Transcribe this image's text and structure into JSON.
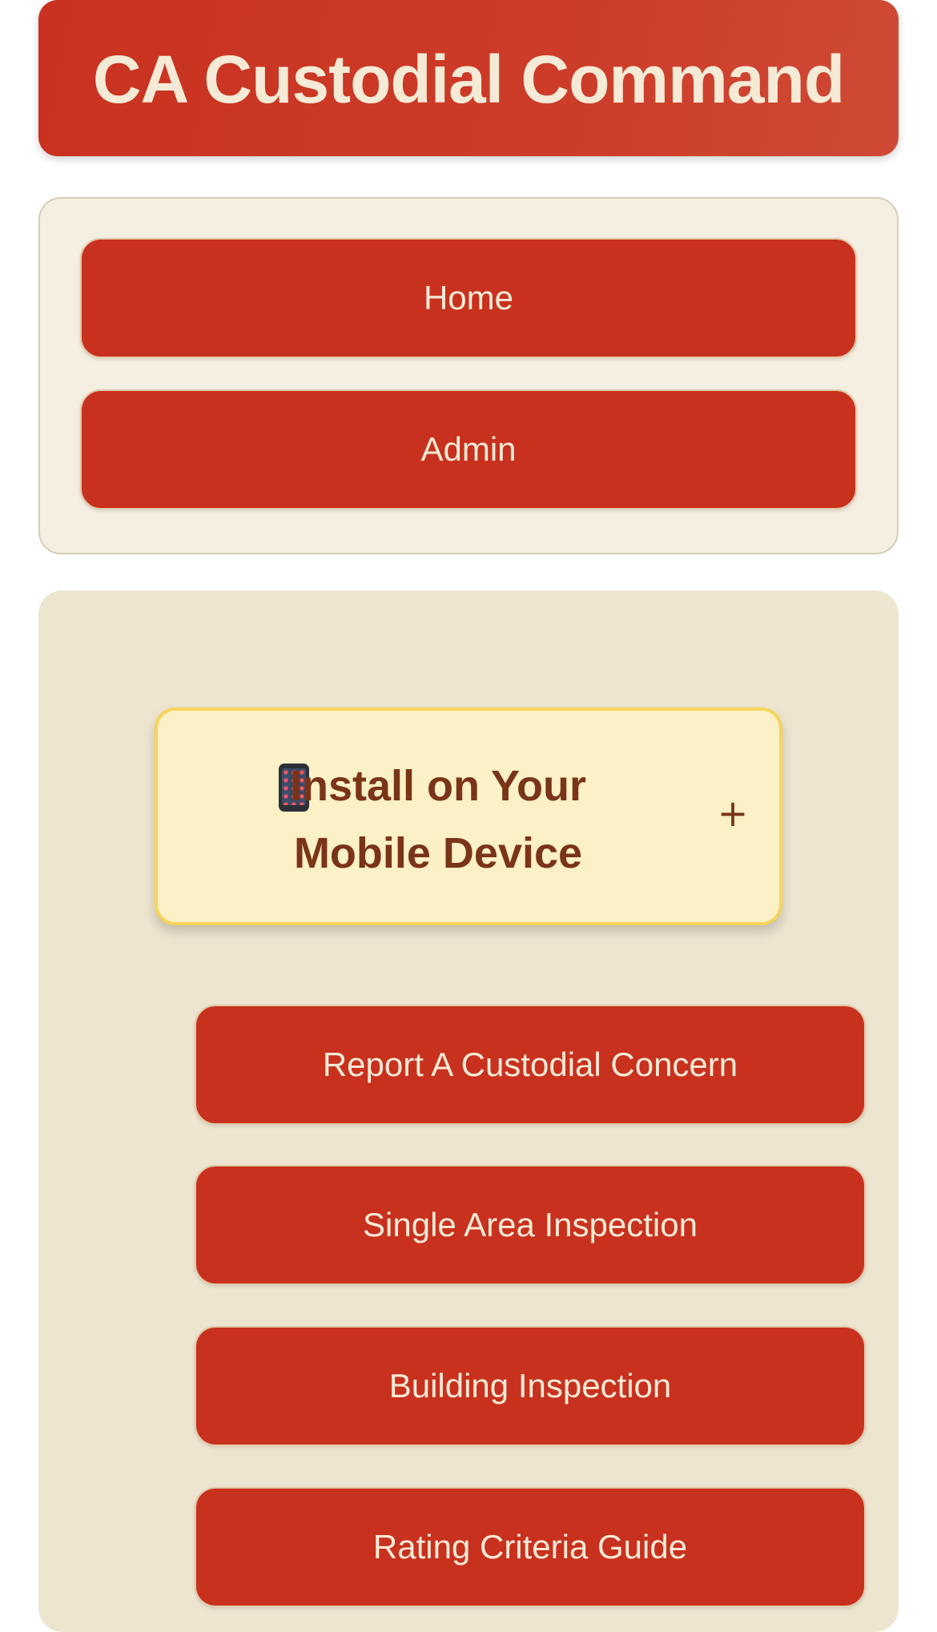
{
  "header": {
    "title": "CA Custodial Command"
  },
  "nav": {
    "items": [
      {
        "label": "Home"
      },
      {
        "label": "Admin"
      }
    ]
  },
  "install": {
    "icon": "mobile-phone-icon",
    "label": "Install on Your Mobile Device",
    "toggle_icon": "plus-icon",
    "toggle_symbol": "+"
  },
  "actions": [
    {
      "label": "Report A Custodial Concern"
    },
    {
      "label": "Single Area Inspection"
    },
    {
      "label": "Building Inspection"
    },
    {
      "label": "Rating Criteria Guide"
    }
  ],
  "colors": {
    "header": "#c93220",
    "button": "#c8311e",
    "button_text": "#f6ead6",
    "nav_card": "#f5efe1",
    "main_card": "#ede5d0",
    "install_bg": "#fcf0c6",
    "install_border": "#f6d35a",
    "install_text": "#7a3417"
  }
}
